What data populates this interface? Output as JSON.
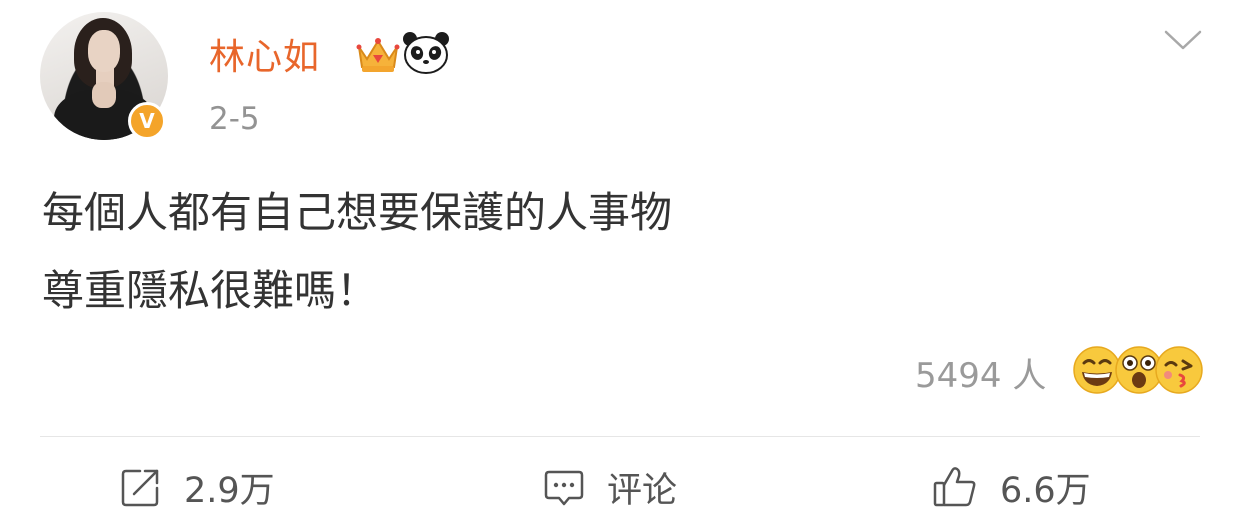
{
  "post": {
    "username": "林心如",
    "date": "2-5",
    "content_lines": [
      "每個人都有自己想要保護的人事物",
      "尊重隱私很難嗎！"
    ],
    "verified_badge": "V"
  },
  "reactions": {
    "count_label": "5494 人",
    "emojis": [
      "grinning-emoji",
      "surprised-emoji",
      "kissing-emoji"
    ]
  },
  "actions": {
    "repost_label": "2.9万",
    "comment_label": "评论",
    "like_label": "6.6万"
  },
  "colors": {
    "username": "#e8662b",
    "badge": "#f4a42a",
    "text": "#333333",
    "muted": "#939393"
  }
}
